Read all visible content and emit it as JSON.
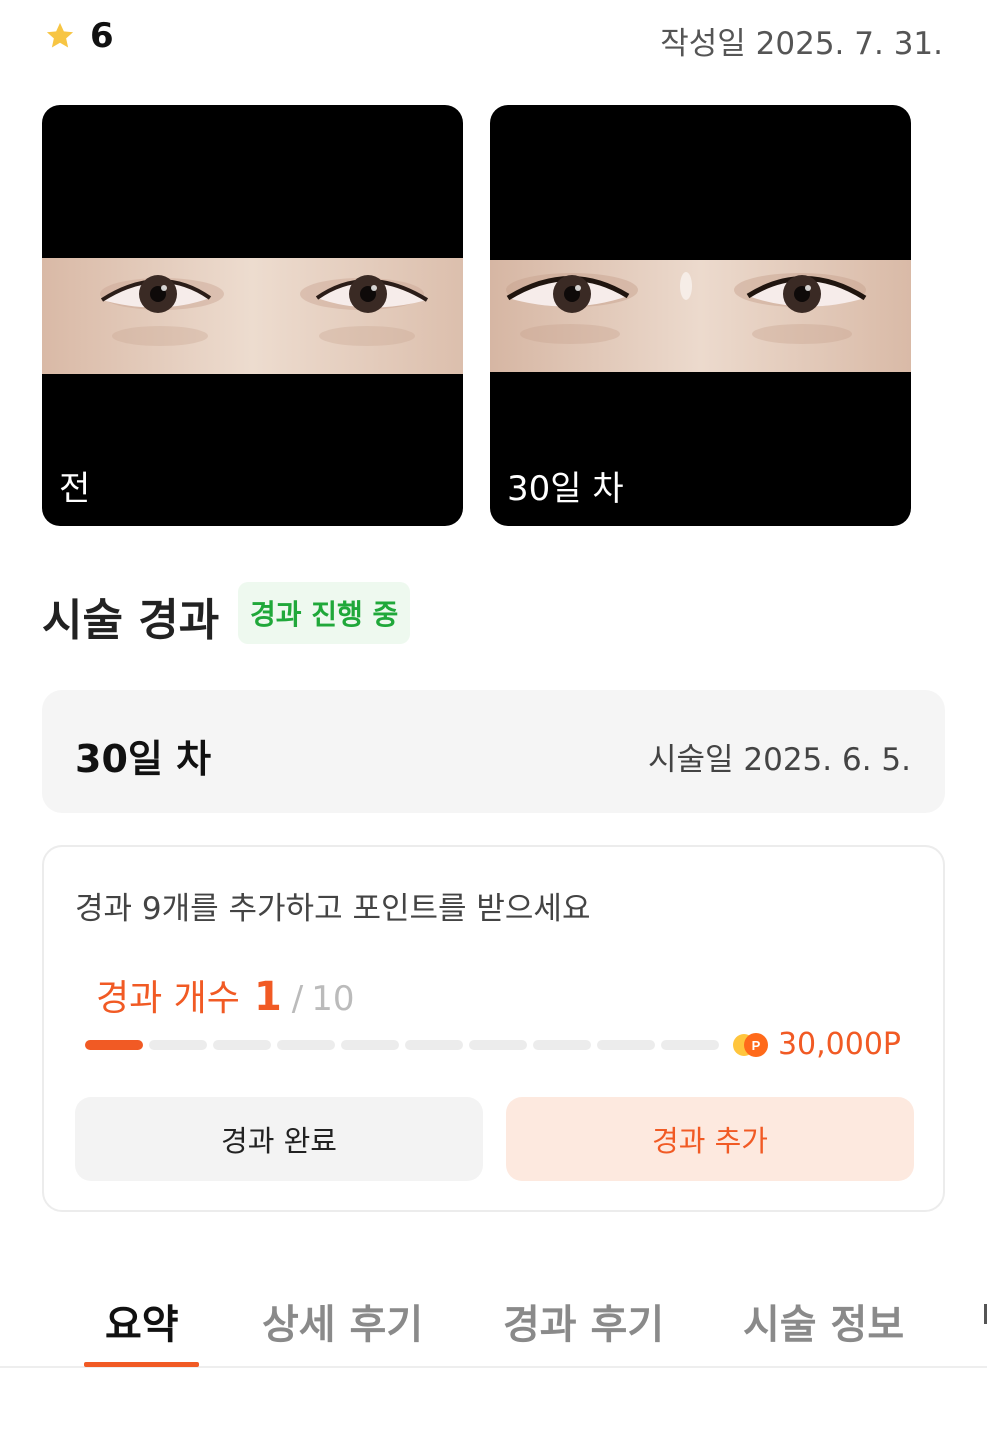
{
  "header": {
    "rating_icon": "star-icon",
    "rating_value": "6",
    "written_date": "작성일 2025. 7. 31."
  },
  "photos": {
    "before_caption": "전",
    "after_caption": "30일 차"
  },
  "result_section": {
    "title": "시술 경과",
    "status_badge": "경과 진행 중",
    "status_color": "#20a83a"
  },
  "day_box": {
    "day_label": "30일 차",
    "procedure_date": "시술일 2025. 6. 5."
  },
  "progress_card": {
    "prompt": "경과 9개를 추가하고 포인트를 받으세요",
    "count_label": "경과 개수",
    "count_current": "1",
    "count_separator": "/",
    "count_total": "10",
    "segments_filled": 1,
    "segments_total": 10,
    "reward_icon": "point-coin-icon",
    "reward_points": "30,000P",
    "accent_color": "#f15a24",
    "buttons": {
      "complete": "경과 완료",
      "add": "경과 추가"
    }
  },
  "tabs": [
    {
      "label": "요약",
      "active": true
    },
    {
      "label": "상세 후기",
      "active": false
    },
    {
      "label": "경과 후기",
      "active": false
    },
    {
      "label": "시술 정보",
      "active": false
    }
  ]
}
